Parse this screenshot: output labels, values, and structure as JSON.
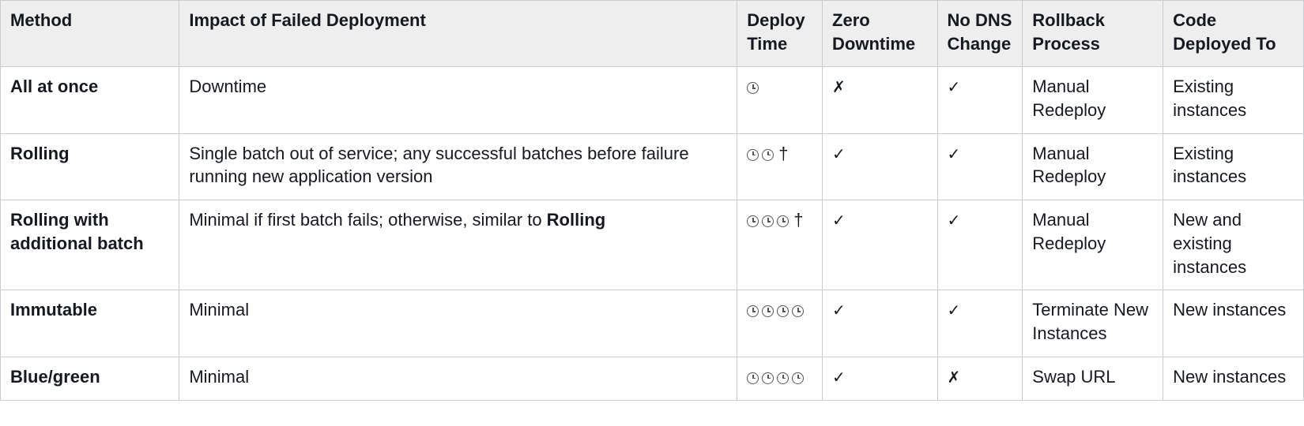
{
  "table": {
    "headers": {
      "method": "Method",
      "impact": "Impact of Failed Deployment",
      "deploy": "Deploy Time",
      "zero": "Zero Downtime",
      "dns": "No DNS Change",
      "rollback": "Rollback Process",
      "code": "Code Deployed To"
    },
    "symbols": {
      "check": "✓",
      "cross": "✗",
      "dagger": "†"
    },
    "rows": [
      {
        "method": "All at once",
        "impact_plain": "Downtime",
        "deploy_clocks": 1,
        "deploy_dagger": false,
        "zero": "cross",
        "dns": "check",
        "rollback": "Manual Redeploy",
        "code": "Existing instances"
      },
      {
        "method": "Rolling",
        "impact_plain": "Single batch out of service; any successful batches before failure running new application version",
        "deploy_clocks": 2,
        "deploy_dagger": true,
        "zero": "check",
        "dns": "check",
        "rollback": "Manual Redeploy",
        "code": "Existing instances"
      },
      {
        "method": "Rolling with additional batch",
        "impact_pre": "Minimal if first batch fails; otherwise, similar to ",
        "impact_bold": "Rolling",
        "deploy_clocks": 3,
        "deploy_dagger": true,
        "zero": "check",
        "dns": "check",
        "rollback": "Manual Redeploy",
        "code": "New and existing instances"
      },
      {
        "method": "Immutable",
        "impact_plain": "Minimal",
        "deploy_clocks": 4,
        "deploy_dagger": false,
        "zero": "check",
        "dns": "check",
        "rollback": "Terminate New Instances",
        "code": "New instances"
      },
      {
        "method": "Blue/green",
        "impact_plain": "Minimal",
        "deploy_clocks": 4,
        "deploy_dagger": false,
        "zero": "check",
        "dns": "cross",
        "rollback": "Swap URL",
        "code": "New instances"
      }
    ]
  }
}
